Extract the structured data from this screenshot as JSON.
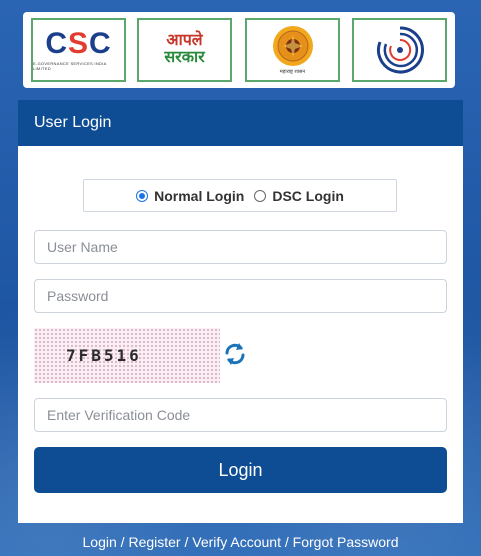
{
  "logos": {
    "csc": {
      "wordmark": "CSC",
      "tagline": "E-GOVERNANCE SERVICES INDIA LIMITED",
      "accent": "#e23b2f",
      "icon": "csc-logo-icon"
    },
    "aaple_sarkar": {
      "line1": "आपले",
      "line2": "सरकार",
      "icon": "aaple-sarkar-logo-icon"
    },
    "maharashtra_seal": {
      "caption": "महाराष्ट्र शासन",
      "icon": "maharashtra-seal-icon"
    },
    "egov": {
      "icon": "e-governance-logo-icon"
    }
  },
  "login": {
    "header": "User Login",
    "mode_options": [
      {
        "label": "Normal Login",
        "selected": true
      },
      {
        "label": "DSC Login",
        "selected": false
      }
    ],
    "username_placeholder": "User Name",
    "password_placeholder": "Password",
    "captcha_text": "7FB516",
    "refresh_icon": "refresh-icon",
    "verification_placeholder": "Enter Verification Code",
    "submit_label": "Login"
  },
  "footer": {
    "links": [
      "Login",
      "Register",
      "Verify Account",
      "Forgot Password"
    ],
    "separator": " / "
  },
  "colors": {
    "primary": "#0e4d94",
    "background": "#1f5aa8",
    "radio_accent": "#1a73e8"
  }
}
